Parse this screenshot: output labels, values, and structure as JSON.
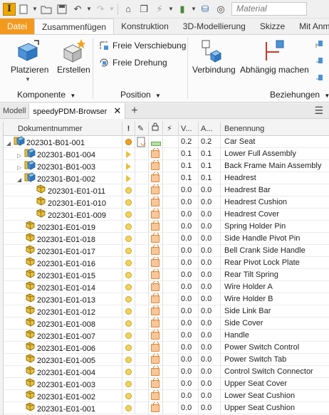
{
  "quick_access": {
    "material_placeholder": "Material"
  },
  "ribbon_tabs": [
    "Datei",
    "Zusammenfügen",
    "Konstruktion",
    "3D-Modellierung",
    "Skizze",
    "Mit Anm"
  ],
  "ribbon": {
    "platzieren": "Platzieren",
    "erstellen": "Erstellen",
    "freie_verschiebung": "Freie Verschiebung",
    "freie_drehung": "Freie Drehung",
    "verbindung": "Verbindung",
    "abhaengig_machen": "Abhängig machen",
    "group_komponente": "Komponente",
    "group_position": "Position",
    "group_beziehungen": "Beziehungen"
  },
  "browser": {
    "modell_tab": "Modell",
    "pdm_tab": "speedyPDM-Browser",
    "columns": {
      "docnum": "Dokumentnummer",
      "warn": "!",
      "v": "V...",
      "a": "A...",
      "benennung": "Benennung"
    },
    "rows": [
      {
        "docnum": "202301-B01-001",
        "type": "assembly",
        "level": 0,
        "expander": "◢",
        "status": "dot-orange",
        "v": "0.2",
        "a": "0.2",
        "benennung": "Car Seat"
      },
      {
        "docnum": "202301-B01-004",
        "type": "assembly",
        "level": 1,
        "expander": "▷",
        "status": "flag",
        "v": "0.1",
        "a": "0.1",
        "benennung": "Lower Full Assembly"
      },
      {
        "docnum": "202301-B01-003",
        "type": "assembly",
        "level": 1,
        "expander": "▷",
        "status": "flag",
        "v": "0.1",
        "a": "0.1",
        "benennung": "Back Frame Main Assembly"
      },
      {
        "docnum": "202301-B01-002",
        "type": "assembly",
        "level": 1,
        "expander": "◢",
        "status": "flag",
        "v": "0.1",
        "a": "0.1",
        "benennung": "Headrest"
      },
      {
        "docnum": "202301-E01-011",
        "type": "part",
        "level": 2,
        "expander": "",
        "status": "dot-yellow",
        "v": "0.0",
        "a": "0.0",
        "benennung": "Headrest Bar"
      },
      {
        "docnum": "202301-E01-010",
        "type": "part",
        "level": 2,
        "expander": "",
        "status": "dot-yellow",
        "v": "0.0",
        "a": "0.0",
        "benennung": "Headrest Cushion"
      },
      {
        "docnum": "202301-E01-009",
        "type": "part",
        "level": 2,
        "expander": "",
        "status": "dot-yellow",
        "v": "0.0",
        "a": "0.0",
        "benennung": "Headrest Cover"
      },
      {
        "docnum": "202301-E01-019",
        "type": "part",
        "level": 1,
        "expander": "",
        "status": "dot-yellow",
        "v": "0.0",
        "a": "0.0",
        "benennung": "Spring Holder Pin"
      },
      {
        "docnum": "202301-E01-018",
        "type": "part",
        "level": 1,
        "expander": "",
        "status": "dot-yellow",
        "v": "0.0",
        "a": "0.0",
        "benennung": "Side Handle Pivot Pin"
      },
      {
        "docnum": "202301-E01-017",
        "type": "part",
        "level": 1,
        "expander": "",
        "status": "dot-yellow",
        "v": "0.0",
        "a": "0.0",
        "benennung": "Bell Crank Side Handle"
      },
      {
        "docnum": "202301-E01-016",
        "type": "part",
        "level": 1,
        "expander": "",
        "status": "dot-yellow",
        "v": "0.0",
        "a": "0.0",
        "benennung": "Rear Pivot Lock Plate"
      },
      {
        "docnum": "202301-E01-015",
        "type": "part",
        "level": 1,
        "expander": "",
        "status": "dot-yellow",
        "v": "0.0",
        "a": "0.0",
        "benennung": "Rear Tilt Spring"
      },
      {
        "docnum": "202301-E01-014",
        "type": "part",
        "level": 1,
        "expander": "",
        "status": "dot-yellow",
        "v": "0.0",
        "a": "0.0",
        "benennung": "Wire Holder A"
      },
      {
        "docnum": "202301-E01-013",
        "type": "part",
        "level": 1,
        "expander": "",
        "status": "dot-yellow",
        "v": "0.0",
        "a": "0.0",
        "benennung": "Wire Holder B"
      },
      {
        "docnum": "202301-E01-012",
        "type": "part",
        "level": 1,
        "expander": "",
        "status": "dot-yellow",
        "v": "0.0",
        "a": "0.0",
        "benennung": "Side Link Bar"
      },
      {
        "docnum": "202301-E01-008",
        "type": "part",
        "level": 1,
        "expander": "",
        "status": "dot-yellow",
        "v": "0.0",
        "a": "0.0",
        "benennung": "Side Cover"
      },
      {
        "docnum": "202301-E01-007",
        "type": "part",
        "level": 1,
        "expander": "",
        "status": "dot-yellow",
        "v": "0.0",
        "a": "0.0",
        "benennung": "Handle"
      },
      {
        "docnum": "202301-E01-006",
        "type": "part",
        "level": 1,
        "expander": "",
        "status": "dot-yellow",
        "v": "0.0",
        "a": "0.0",
        "benennung": "Power Switch Control"
      },
      {
        "docnum": "202301-E01-005",
        "type": "part",
        "level": 1,
        "expander": "",
        "status": "dot-yellow",
        "v": "0.0",
        "a": "0.0",
        "benennung": "Power Switch Tab"
      },
      {
        "docnum": "202301-E01-004",
        "type": "part",
        "level": 1,
        "expander": "",
        "status": "dot-yellow",
        "v": "0.0",
        "a": "0.0",
        "benennung": "Control Switch Connector"
      },
      {
        "docnum": "202301-E01-003",
        "type": "part",
        "level": 1,
        "expander": "",
        "status": "dot-yellow",
        "v": "0.0",
        "a": "0.0",
        "benennung": "Upper Seat Cover"
      },
      {
        "docnum": "202301-E01-002",
        "type": "part",
        "level": 1,
        "expander": "",
        "status": "dot-yellow",
        "v": "0.0",
        "a": "0.0",
        "benennung": "Lower Seat Cushion"
      },
      {
        "docnum": "202301-E01-001",
        "type": "part",
        "level": 1,
        "expander": "",
        "status": "dot-yellow",
        "v": "0.0",
        "a": "0.0",
        "benennung": "Upper Seat Cushion"
      }
    ]
  },
  "colors": {
    "file_tab": "#f39a1e",
    "status_orange": "#f2a11d",
    "status_yellow": "#f3d35a",
    "lock_fill": "#f7c79a"
  }
}
